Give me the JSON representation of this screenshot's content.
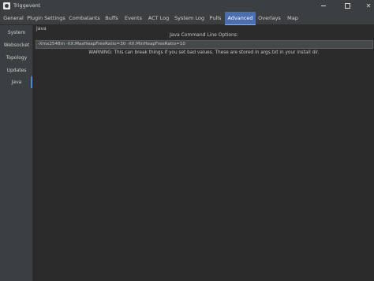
{
  "window": {
    "title": "Triggevent"
  },
  "tabs": [
    {
      "label": "General"
    },
    {
      "label": "Plugin Settings"
    },
    {
      "label": "Combatants"
    },
    {
      "label": "Buffs"
    },
    {
      "label": "Events"
    },
    {
      "label": "ACT Log"
    },
    {
      "label": "System Log"
    },
    {
      "label": "Pulls"
    },
    {
      "label": "Advanced"
    },
    {
      "label": "Overlays"
    },
    {
      "label": "Map"
    }
  ],
  "active_tab": "Advanced",
  "sidebar": {
    "items": [
      {
        "label": "System"
      },
      {
        "label": "Websocket"
      },
      {
        "label": "Topology"
      },
      {
        "label": "Updates"
      },
      {
        "label": "Java"
      }
    ],
    "active": "Java"
  },
  "java": {
    "group_title": "Java",
    "cmd_label": "Java Command Line Options:",
    "cmd_value": "-Xmx2548m -XX:MaxHeapFreeRatio=30 -XX:MinHeapFreeRatio=10",
    "warning": "WARNING: This can break things if you set bad values. These are stored in args.txt in your install dir."
  }
}
